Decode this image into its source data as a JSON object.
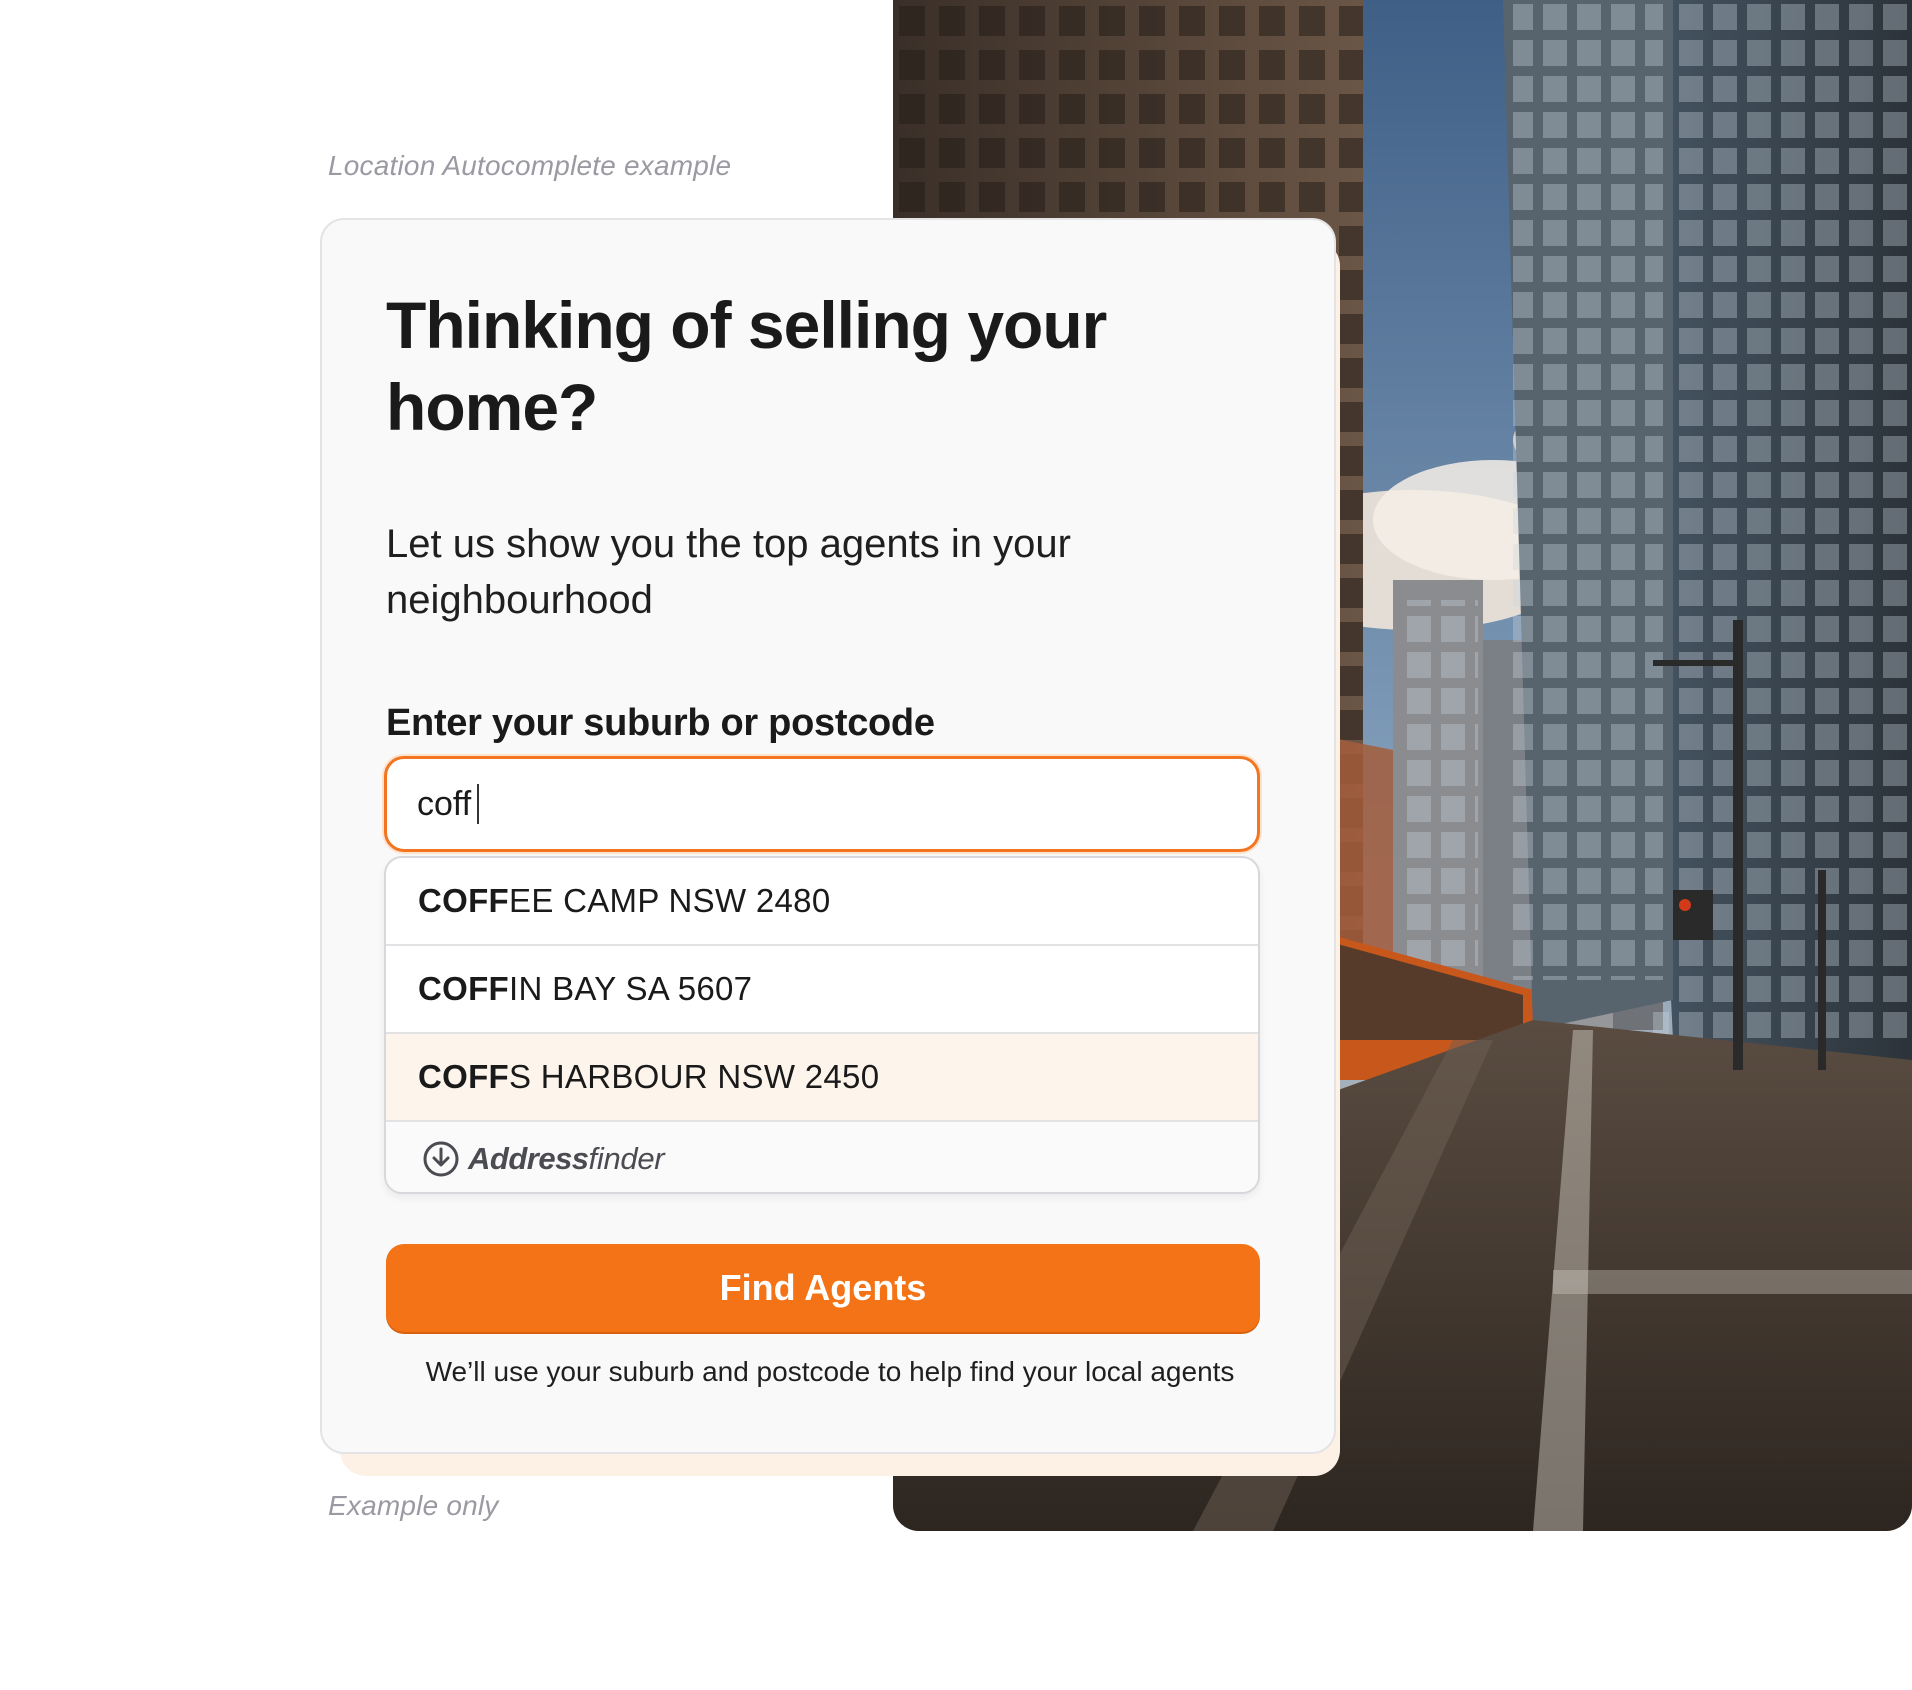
{
  "captions": {
    "top": "Location Autocomplete example",
    "bottom": "Example only"
  },
  "card": {
    "title": "Thinking of selling your home?",
    "subtitle": "Let us show you the top agents in your neighbourhood",
    "field_label": "Enter your suburb or postcode"
  },
  "search": {
    "value": "coff",
    "placeholder": ""
  },
  "suggestions": [
    {
      "match": "COFF",
      "rest": "EE CAMP NSW 2480",
      "highlighted": false
    },
    {
      "match": "COFF",
      "rest": "IN BAY SA 5607",
      "highlighted": false
    },
    {
      "match": "COFF",
      "rest": "S HARBOUR NSW 2450",
      "highlighted": true
    }
  ],
  "powered_by": {
    "brand_bold": "Address",
    "brand_light": "finder",
    "icon": "addressfinder-logo-icon"
  },
  "cta": {
    "label": "Find Agents"
  },
  "disclaimer": "We’ll use your suburb and postcode to help find your local agents",
  "colors": {
    "accent": "#f47317",
    "input_border": "#f47521",
    "highlight_row": "#fdf4ec"
  },
  "background_image": {
    "icon": "city-street-photo"
  }
}
